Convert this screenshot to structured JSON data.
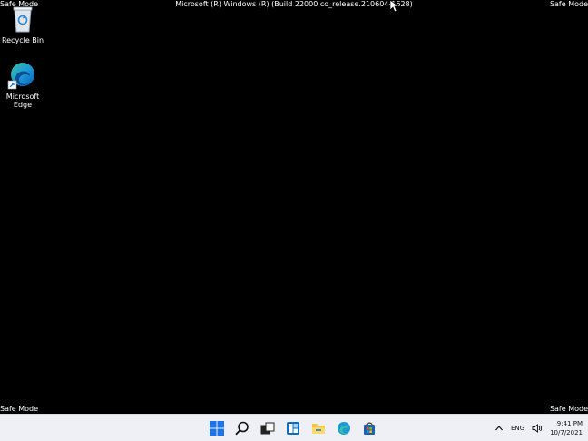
{
  "overlay": {
    "safe_mode_label": "Safe Mode",
    "build_text": "Microsoft (R) Windows (R) (Build 22000.co_release.210604-1628)"
  },
  "desktop": {
    "icons": [
      {
        "label": "Recycle Bin"
      },
      {
        "label": "Microsoft Edge"
      }
    ]
  },
  "taskbar": {
    "apps": [
      {
        "icon": "start-icon"
      },
      {
        "icon": "search-icon"
      },
      {
        "icon": "task-view-icon"
      },
      {
        "icon": "widgets-icon"
      },
      {
        "icon": "file-explorer-icon"
      },
      {
        "icon": "edge-icon"
      },
      {
        "icon": "store-icon"
      }
    ],
    "tray": {
      "language": "ENG",
      "time": "9:41 PM",
      "date": "10/7/2021"
    }
  },
  "colors": {
    "desktop_bg": "#000000",
    "taskbar_bg": "#eef0f6",
    "start_blue": "#1a73e8"
  }
}
